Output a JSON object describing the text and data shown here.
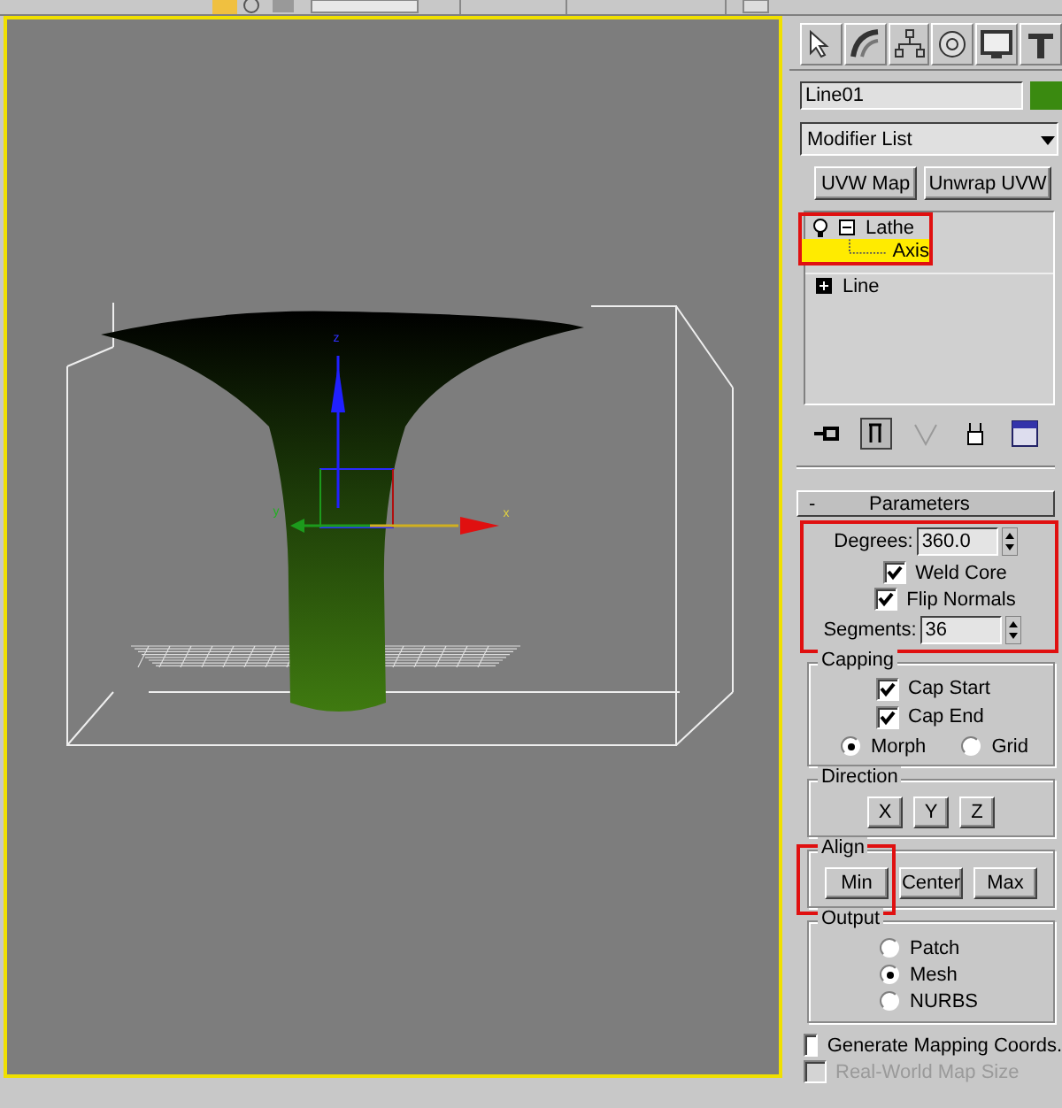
{
  "viewport": {
    "gizmo_labels": [
      "z",
      "y",
      "x"
    ]
  },
  "command_panel": {
    "object_name": "Line01",
    "modifier_list": "Modifier List",
    "modifier_buttons": [
      "UVW Map",
      "Unwrap UVW"
    ],
    "stack": [
      {
        "label": "Lathe",
        "selected": false,
        "expanded": true,
        "children": [
          {
            "label": "Axis",
            "selected": true
          }
        ]
      },
      {
        "label": "Line",
        "selected": false,
        "expanded": false
      }
    ],
    "rollout": {
      "toggle": "-",
      "title": "Parameters"
    },
    "parameters": {
      "degrees": {
        "label": "Degrees:",
        "value": "360.0"
      },
      "checks": [
        {
          "label": "Weld Core",
          "checked": true
        },
        {
          "label": "Flip Normals",
          "checked": true
        }
      ],
      "segments": {
        "label": "Segments:",
        "value": "36"
      }
    },
    "capping": {
      "title": "Capping",
      "checks": [
        {
          "label": "Cap Start",
          "checked": true
        },
        {
          "label": "Cap End",
          "checked": true
        }
      ],
      "modes": [
        {
          "label": "Morph",
          "selected": true
        },
        {
          "label": "Grid",
          "selected": false
        }
      ]
    },
    "direction": {
      "title": "Direction",
      "buttons": [
        "X",
        "Y",
        "Z"
      ]
    },
    "align": {
      "title": "Align",
      "buttons": [
        "Min",
        "Center",
        "Max"
      ]
    },
    "output": {
      "title": "Output",
      "options": [
        {
          "label": "Patch",
          "selected": false
        },
        {
          "label": "Mesh",
          "selected": true
        },
        {
          "label": "NURBS",
          "selected": false
        }
      ]
    },
    "mapping": [
      {
        "label": "Generate Mapping Coords.",
        "checked": false,
        "disabled": false
      },
      {
        "label": "Real-World Map Size",
        "checked": false,
        "disabled": true
      }
    ]
  }
}
